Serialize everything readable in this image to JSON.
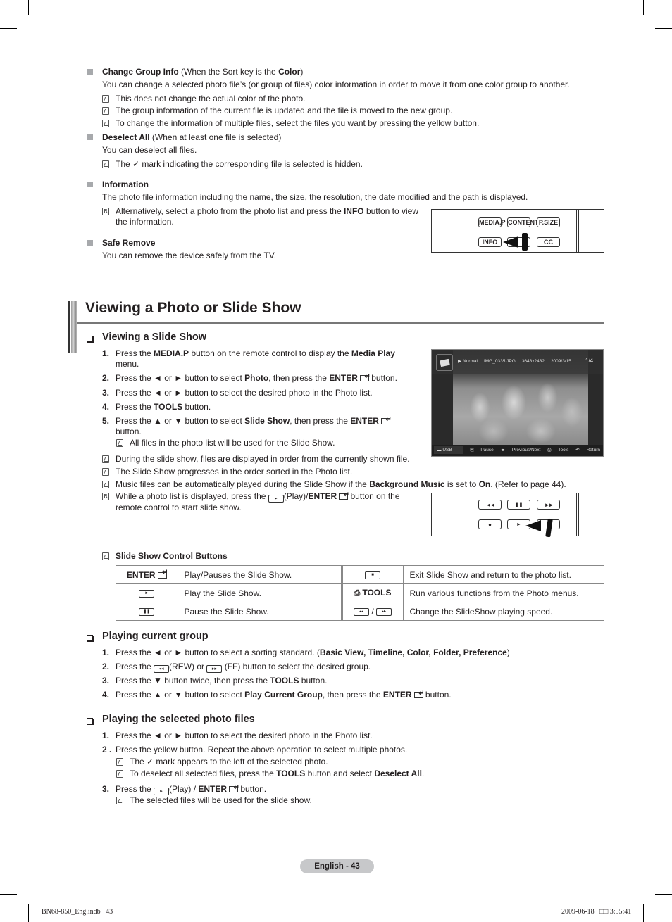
{
  "top_section": {
    "change_group_info": {
      "title": "Change Group Info",
      "qualifier_pre": " (When the Sort key is the ",
      "qualifier_bold": "Color",
      "qualifier_post": ")",
      "description": "You can change a selected photo file’s (or group of files) color information in order to move it from one color group to another.",
      "notes": [
        "This does not change the actual color of the photo.",
        "The group information of the current file is updated and the file is moved to the new group.",
        "To change the information of multiple files, select the files you want by pressing the yellow button."
      ]
    },
    "deselect_all": {
      "title": "Deselect All",
      "qualifier": " (When at least one file is selected)",
      "description": "You can deselect all files.",
      "note_pre": "The ",
      "note_post": " mark indicating the corresponding file is selected is hidden."
    },
    "information": {
      "title": "Information",
      "description": "The photo file information including the name, the size, the resolution, the date modified and the path is displayed.",
      "remote_note_pre": "Alternatively, select a photo from the photo list and press the ",
      "remote_note_bold": "INFO",
      "remote_note_post": " button to view",
      "remote_note_line2": "the information."
    },
    "safe_remove": {
      "title": "Safe Remove",
      "description": "You can remove the device safely from the TV."
    },
    "remote_info": {
      "row1": [
        "MEDIA.P",
        "CONTENT",
        "P.SIZE"
      ],
      "row2": [
        "INFO",
        "",
        "CC"
      ]
    }
  },
  "section": {
    "title": "Viewing a Photo or Slide Show"
  },
  "slide_show": {
    "heading": "Viewing a Slide Show",
    "steps": [
      {
        "num": "1.",
        "parts": [
          "Press the ",
          "MEDIA.P",
          " button on the remote control to display the ",
          "Media Play"
        ],
        "line2": "menu."
      },
      {
        "num": "2.",
        "parts": [
          "Press the ◄ or ► button to select ",
          "Photo",
          ", then press the ",
          "ENTER",
          " button."
        ]
      },
      {
        "num": "3.",
        "text": "Press the ◄ or ► button to select the desired photo in the Photo list."
      },
      {
        "num": "4.",
        "parts": [
          "Press the ",
          "TOOLS",
          " button."
        ]
      },
      {
        "num": "5.",
        "parts": [
          "Press the ▲ or ▼ button to select ",
          "Slide Show",
          ", then press the ",
          "ENTER"
        ],
        "line2": "button.",
        "note": "All files in the photo list will be used for the Slide Show."
      }
    ],
    "notes": [
      "During the slide show, files are displayed in order from the currently shown file.",
      "The Slide Show progresses in the order sorted in the Photo list."
    ],
    "music_note": {
      "pre": "Music files can be automatically played during the Slide Show if the ",
      "bold1": "Background Music",
      "mid": " is set to ",
      "bold2": "On",
      "post": ". (Refer to page 44)."
    },
    "remote_note": {
      "pre": "While a photo list is displayed, press the ",
      "mid": "(Play)/",
      "bold": "ENTER",
      "post": " button on the",
      "line2": "remote control to start slide show."
    },
    "tv_screen": {
      "mode": "Normal",
      "filename": "IMG_0335.JPG",
      "resolution": "3648x2432",
      "date": "2009/3/15",
      "counter": "1/4",
      "device": "USB",
      "hints": [
        "Pause",
        "Previous/Next",
        "Tools",
        "Return"
      ]
    },
    "remote_play": {
      "row1": [
        "◄◄",
        "❚❚",
        "►►"
      ],
      "row2": [
        "●",
        "►",
        ""
      ]
    }
  },
  "control_buttons": {
    "title": "Slide Show Control Buttons",
    "rows": [
      {
        "key_left": "ENTER",
        "desc_left": "Play/Pauses the Slide Show.",
        "key_right": "■",
        "desc_right": "Exit Slide Show and return to the photo list."
      },
      {
        "key_left": "►",
        "desc_left": "Play the Slide Show.",
        "key_right": "TOOLS",
        "desc_right": "Run various functions from the Photo menus."
      },
      {
        "key_left": "❚❚",
        "desc_left": "Pause the Slide Show.",
        "key_right": "◄◄ / ►►",
        "desc_right": "Change the  SlideShow playing speed."
      }
    ]
  },
  "playing_current_group": {
    "heading": "Playing current group",
    "steps": [
      {
        "num": "1.",
        "pre": "Press the ◄ or ► button to select a sorting standard. (",
        "bold": "Basic View, Timeline, Color, Folder, Preference",
        "post": ")"
      },
      {
        "num": "2.",
        "pre": "Press the ",
        "mid": "(REW) or ",
        "post": " (FF) button to select the desired group."
      },
      {
        "num": "3.",
        "pre": "Press the ▼ button twice, then press the ",
        "bold": "TOOLS",
        "post": " button."
      },
      {
        "num": "4.",
        "pre": "Press the ▲ or ▼ button to select ",
        "bold": "Play Current Group",
        "mid": ", then press the ",
        "bold2": "ENTER",
        "post": " button."
      }
    ]
  },
  "playing_selected": {
    "heading": "Playing the selected photo files",
    "step1": {
      "num": "1.",
      "text": "Press the ◄ or ► button to select the desired photo in the Photo list."
    },
    "step2": {
      "num": "2 .",
      "text": "Press the yellow button. Repeat the above operation to select multiple photos."
    },
    "note1_pre": "The ",
    "note1_post": " mark appears to the left of the selected photo.",
    "note2": {
      "pre": "To deselect all selected files, press the ",
      "bold1": "TOOLS",
      "mid": " button and select ",
      "bold2": "Deselect All",
      "post": "."
    },
    "step3": {
      "num": "3.",
      "pre": "Press the ",
      "mid": "(Play) / ",
      "bold": "ENTER",
      "post": " button."
    },
    "note3": "The selected files will be used for the slide show."
  },
  "footer": {
    "page_label": "English - 43",
    "file": "BN68-850_Eng.indb   43",
    "timestamp": "2009-06-18   □□ 3:55:41"
  }
}
